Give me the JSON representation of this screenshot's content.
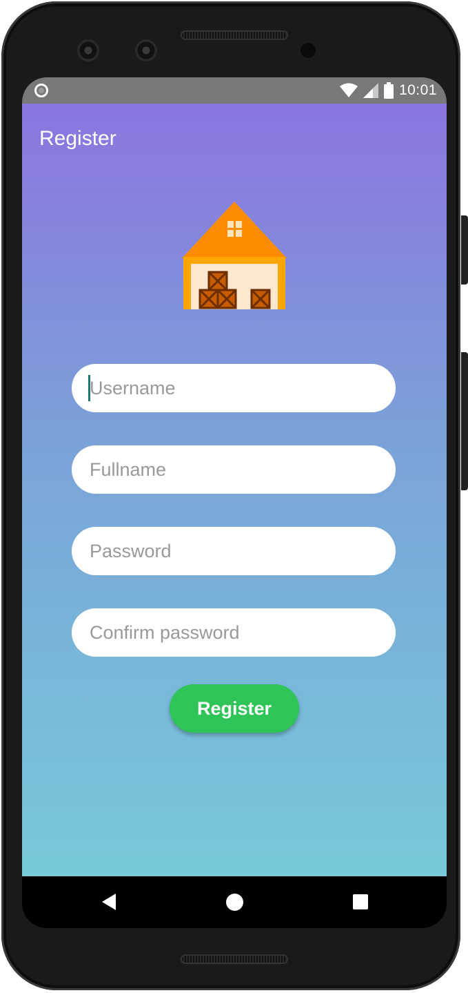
{
  "status_bar": {
    "time": "10:01"
  },
  "app_bar": {
    "title": "Register"
  },
  "form": {
    "username_placeholder": "Username",
    "fullname_placeholder": "Fullname",
    "password_placeholder": "Password",
    "confirm_password_placeholder": "Confirm password",
    "submit_label": "Register"
  },
  "colors": {
    "gradient_top": "#8b75df",
    "gradient_bottom": "#77c9d9",
    "button": "#2ec457",
    "logo_roof": "#ff8c00"
  },
  "icons": {
    "logo": "warehouse-icon",
    "nav_back": "back-triangle-icon",
    "nav_home": "home-circle-icon",
    "nav_recent": "recent-apps-square-icon"
  }
}
